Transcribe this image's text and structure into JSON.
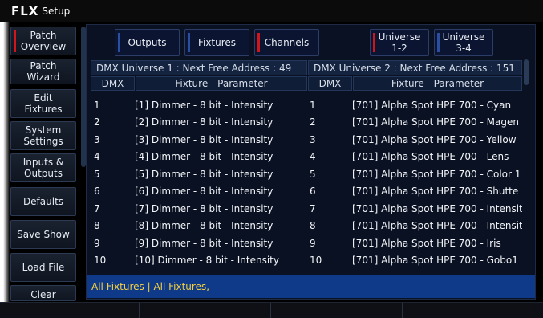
{
  "app": {
    "logo": "FLX",
    "title": "Setup"
  },
  "sidebar": {
    "items": [
      {
        "label": "Patch Overview",
        "active": true
      },
      {
        "label": "Patch Wizard",
        "active": false
      },
      {
        "label": "Edit Fixtures",
        "active": false
      },
      {
        "label": "System Settings",
        "active": false
      },
      {
        "label": "Inputs & Outputs",
        "active": false
      },
      {
        "label": "Defaults",
        "active": false
      },
      {
        "label": "Save Show",
        "active": false
      },
      {
        "label": "Load File",
        "active": false
      },
      {
        "label": "Clear",
        "active": false
      }
    ]
  },
  "tabs": [
    {
      "label": "Outputs",
      "active": false
    },
    {
      "label": "Fixtures",
      "active": false
    },
    {
      "label": "Channels",
      "active": true
    }
  ],
  "universes": [
    {
      "label": "Universe\n1-2",
      "active": true
    },
    {
      "label": "Universe\n3-4",
      "active": false
    }
  ],
  "universe1": {
    "header": "DMX Universe 1 : Next Free Address : 49",
    "col_dmx": "DMX",
    "col_param": "Fixture - Parameter",
    "rows": [
      {
        "dmx": "1",
        "param": "[1] Dimmer - 8 bit - Intensity"
      },
      {
        "dmx": "2",
        "param": "[2] Dimmer - 8 bit - Intensity"
      },
      {
        "dmx": "3",
        "param": "[3] Dimmer - 8 bit - Intensity"
      },
      {
        "dmx": "4",
        "param": "[4] Dimmer - 8 bit - Intensity"
      },
      {
        "dmx": "5",
        "param": "[5] Dimmer - 8 bit - Intensity"
      },
      {
        "dmx": "6",
        "param": "[6] Dimmer - 8 bit - Intensity"
      },
      {
        "dmx": "7",
        "param": "[7] Dimmer - 8 bit - Intensity"
      },
      {
        "dmx": "8",
        "param": "[8] Dimmer - 8 bit - Intensity"
      },
      {
        "dmx": "9",
        "param": "[9] Dimmer - 8 bit - Intensity"
      },
      {
        "dmx": "10",
        "param": "[10] Dimmer - 8 bit - Intensity"
      }
    ]
  },
  "universe2": {
    "header": "DMX Universe 2 : Next Free Address : 151",
    "col_dmx": "DMX",
    "col_param": "Fixture - Parameter",
    "rows": [
      {
        "dmx": "1",
        "param": "[701] Alpha Spot HPE 700 - Cyan"
      },
      {
        "dmx": "2",
        "param": "[701] Alpha Spot HPE 700 - Magen"
      },
      {
        "dmx": "3",
        "param": "[701] Alpha Spot HPE 700 - Yellow"
      },
      {
        "dmx": "4",
        "param": "[701] Alpha Spot HPE 700 - Lens"
      },
      {
        "dmx": "5",
        "param": "[701] Alpha Spot HPE 700 - Color 1"
      },
      {
        "dmx": "6",
        "param": "[701] Alpha Spot HPE 700 - Shutte"
      },
      {
        "dmx": "7",
        "param": "[701] Alpha Spot HPE 700 - Intensit"
      },
      {
        "dmx": "8",
        "param": "[701] Alpha Spot HPE 700 - Intensit"
      },
      {
        "dmx": "9",
        "param": "[701] Alpha Spot HPE 700 - Iris"
      },
      {
        "dmx": "10",
        "param": "[701] Alpha Spot HPE 700 - Gobo1"
      }
    ]
  },
  "status": "All Fixtures |  All Fixtures,",
  "colors": {
    "accent_red": "#d0161b",
    "status_bg": "#0f3a8a",
    "status_text": "#f4d03f"
  }
}
